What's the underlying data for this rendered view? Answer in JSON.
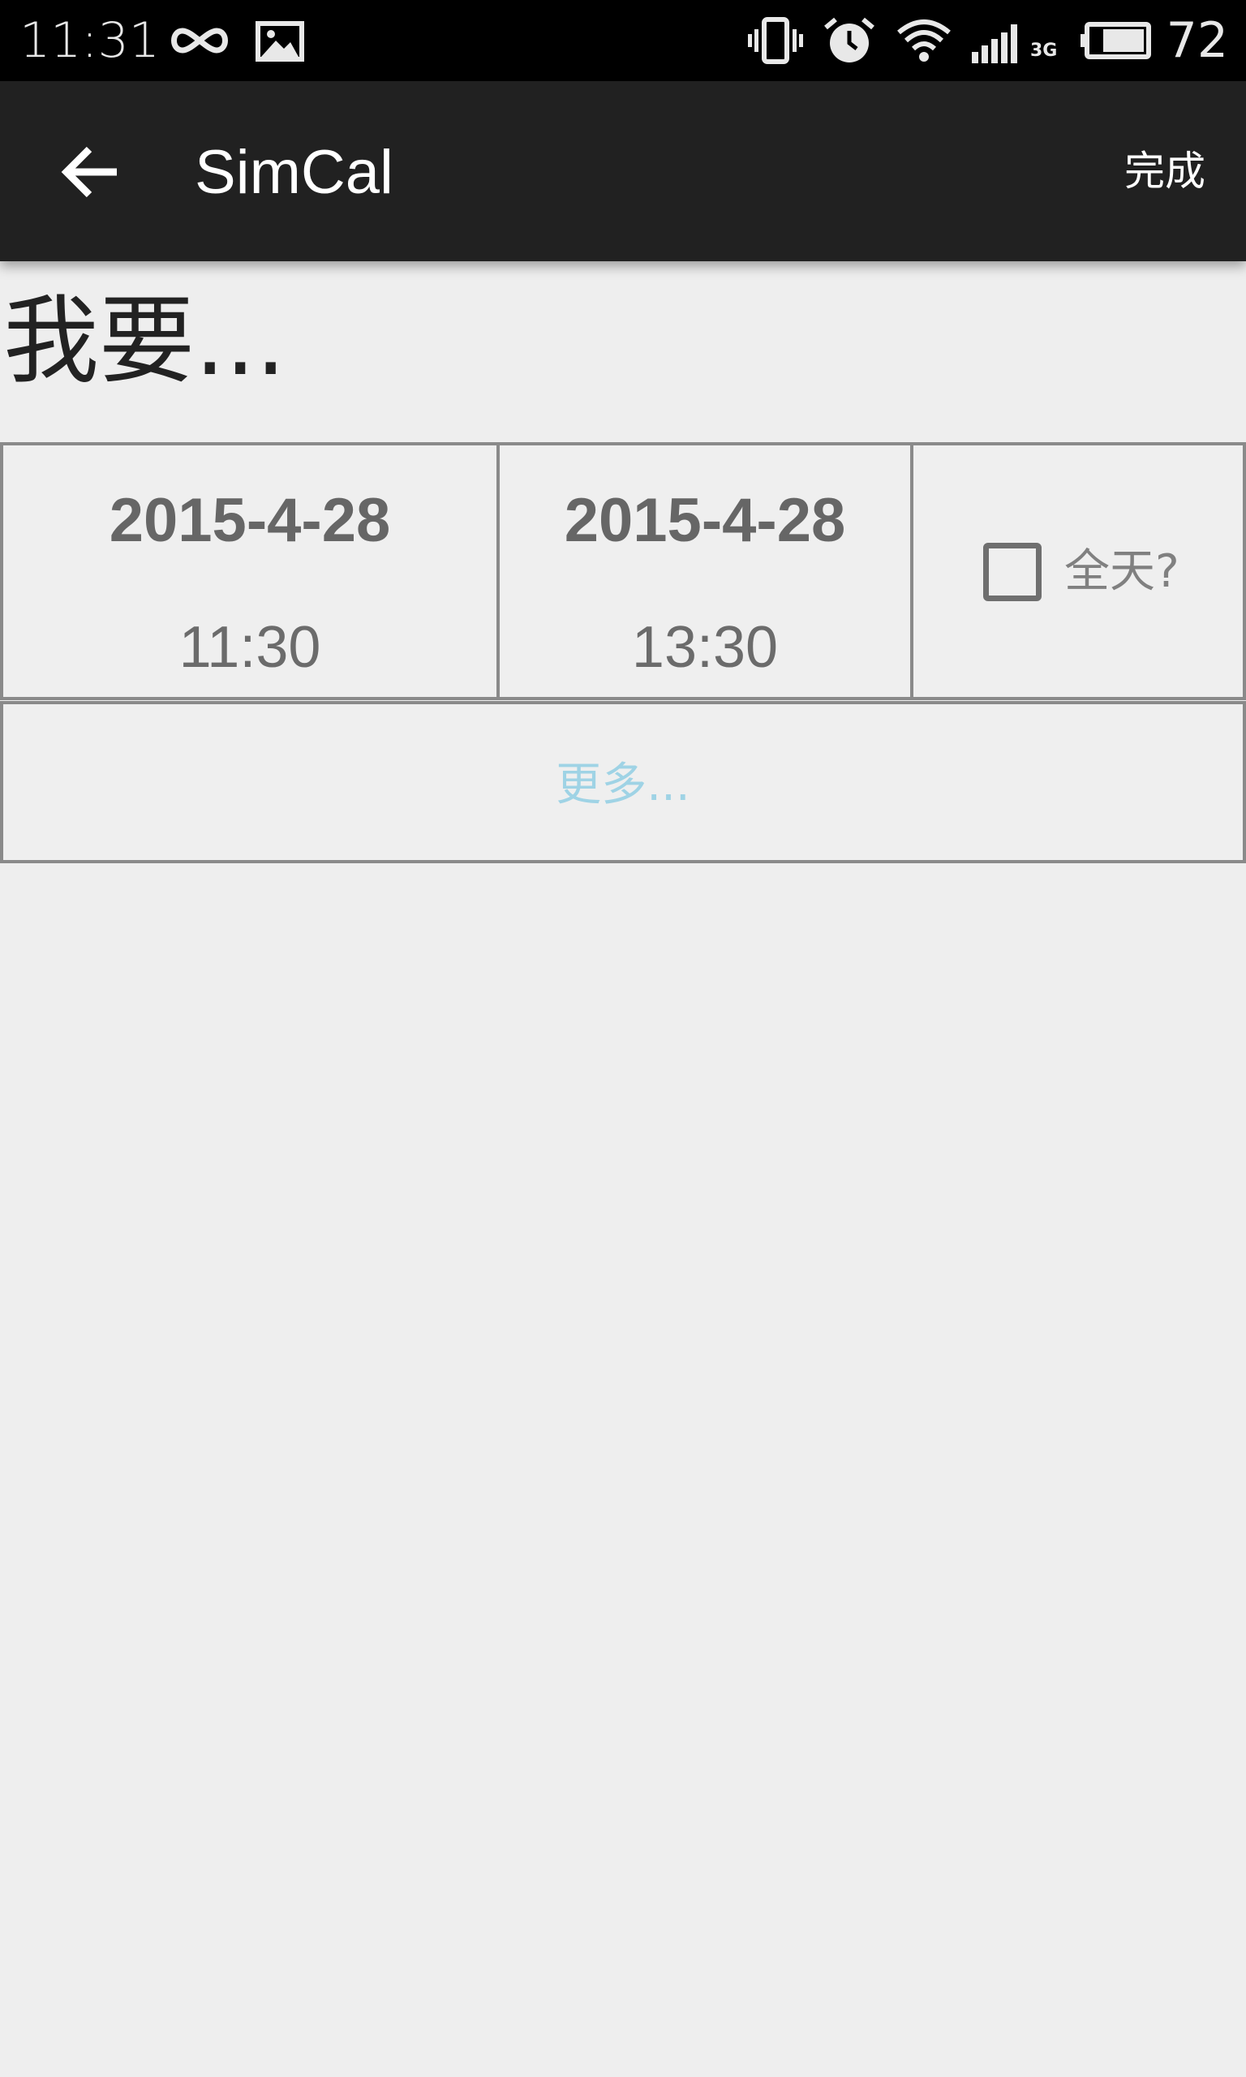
{
  "status_bar": {
    "time": "11:31",
    "battery_percent": "72",
    "network_label": "3G",
    "icons": [
      "infinity-icon",
      "image-icon",
      "vibrate-icon",
      "alarm-icon",
      "wifi-icon",
      "signal-icon",
      "battery-icon"
    ]
  },
  "app_bar": {
    "title": "SimCal",
    "done_label": "完成",
    "back_icon": "arrow-back-icon"
  },
  "form": {
    "heading": "我要...",
    "start": {
      "date": "2015-4-28",
      "time": "11:30"
    },
    "end": {
      "date": "2015-4-28",
      "time": "13:30"
    },
    "all_day": {
      "label": "全天?",
      "checked": false
    },
    "more_label": "更多..."
  },
  "colors": {
    "app_bar": "#212121",
    "background": "#eeeeee",
    "more_text": "#9fd3e5",
    "cell_border": "#8a8a8a"
  }
}
